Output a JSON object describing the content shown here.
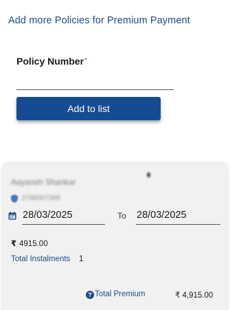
{
  "header": {
    "title": "Add more Policies for Premium Payment"
  },
  "form": {
    "policy_label": "Policy Number",
    "required_mark": "*",
    "policy_value": "",
    "add_button_label": "Add to list"
  },
  "card": {
    "holder_name": "Aayansh Shankar",
    "policy_number": "2786007399",
    "date_from": "28/03/2025",
    "to_label": "To",
    "date_to": "28/03/2025",
    "currency_symbol": "₹",
    "amount": "4915.00",
    "instalments_label": "Total Instalments",
    "instalments_count": "1",
    "help_glyph": "?",
    "total_premium_label": "Total Premium",
    "total_premium_value": "₹ 4,915.00"
  },
  "colors": {
    "primary": "#154c91",
    "link_text": "#1d4c87",
    "required": "#d33a2c",
    "card_bg": "#f1f1f1"
  },
  "icons": [
    "calendar-icon",
    "shield-icon",
    "rupee-icon",
    "help-icon"
  ]
}
